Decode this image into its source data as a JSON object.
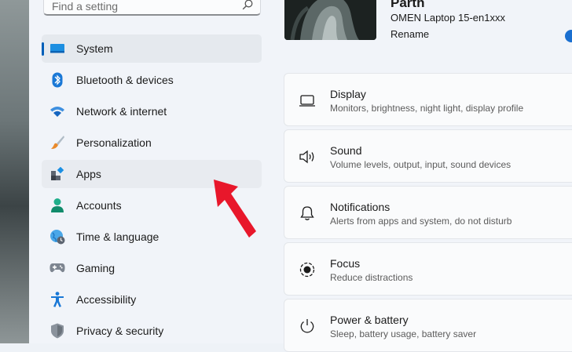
{
  "search": {
    "placeholder": "Find a setting"
  },
  "nav": {
    "items": [
      {
        "label": "System",
        "icon": "system-icon"
      },
      {
        "label": "Bluetooth & devices",
        "icon": "bluetooth-icon"
      },
      {
        "label": "Network & internet",
        "icon": "wifi-icon"
      },
      {
        "label": "Personalization",
        "icon": "brush-icon"
      },
      {
        "label": "Apps",
        "icon": "apps-icon"
      },
      {
        "label": "Accounts",
        "icon": "person-icon"
      },
      {
        "label": "Time & language",
        "icon": "globe-clock-icon"
      },
      {
        "label": "Gaming",
        "icon": "gamepad-icon"
      },
      {
        "label": "Accessibility",
        "icon": "accessibility-icon"
      },
      {
        "label": "Privacy & security",
        "icon": "shield-icon"
      }
    ]
  },
  "profile": {
    "name": "Parth",
    "device": "OMEN Laptop 15-en1xxx",
    "rename_label": "Rename"
  },
  "cards": [
    {
      "title": "Display",
      "desc": "Monitors, brightness, night light, display profile",
      "icon": "monitor-icon"
    },
    {
      "title": "Sound",
      "desc": "Volume levels, output, input, sound devices",
      "icon": "speaker-icon"
    },
    {
      "title": "Notifications",
      "desc": "Alerts from apps and system, do not disturb",
      "icon": "bell-icon"
    },
    {
      "title": "Focus",
      "desc": "Reduce distractions",
      "icon": "focus-icon"
    },
    {
      "title": "Power & battery",
      "desc": "Sleep, battery usage, battery saver",
      "icon": "power-icon"
    }
  ],
  "colors": {
    "accent": "#005fb8",
    "arrow": "#e8172b"
  }
}
